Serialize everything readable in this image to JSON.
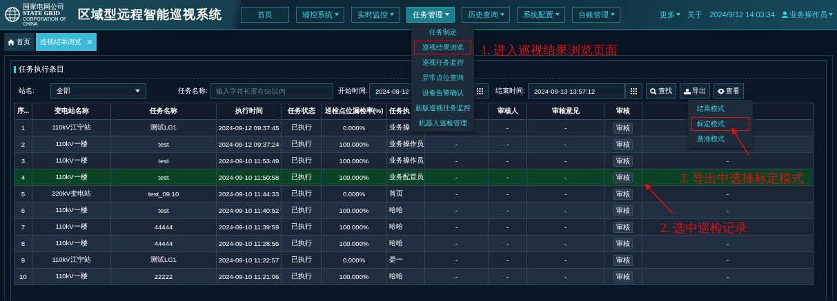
{
  "header": {
    "logo_lines": [
      "国家电网公司",
      "STATE GRID",
      "CORPORATION OF CHINA"
    ],
    "title": "区域型远程智能巡视系统",
    "nav": [
      {
        "label": "首页",
        "dropdown": false,
        "selected": false
      },
      {
        "label": "辅控系统",
        "dropdown": true,
        "selected": false
      },
      {
        "label": "实时监控",
        "dropdown": true,
        "selected": false
      },
      {
        "label": "任务管理",
        "dropdown": true,
        "selected": true
      },
      {
        "label": "历史查询",
        "dropdown": true,
        "selected": false
      },
      {
        "label": "系统配置",
        "dropdown": true,
        "selected": false
      },
      {
        "label": "台账管理",
        "dropdown": true,
        "selected": false
      }
    ],
    "more": "更多",
    "about": "关于",
    "datetime": "2024/9/12 14:03:34",
    "user": "业务操作员"
  },
  "tabs": [
    {
      "label": "首页",
      "kind": "home",
      "selected": false
    },
    {
      "label": "巡视结果浏览",
      "kind": "closable",
      "selected": true
    }
  ],
  "panel": {
    "title": "任务执行条目",
    "filters": {
      "station_label": "站名:",
      "station_value": "全部",
      "task_label": "任务名称:",
      "task_placeholder": "输入字符长度在50以内",
      "start_label": "开始时间:",
      "start_value": "2024-08-12",
      "end_label": "结束时间:",
      "end_value": "2024-09-13 13:57:12"
    },
    "buttons": [
      {
        "label": "查找",
        "kind": "search"
      },
      {
        "label": "导出",
        "kind": "export"
      },
      {
        "label": "查看",
        "kind": "view"
      }
    ],
    "table": {
      "columns": [
        {
          "label": "序..."
        },
        {
          "label": "变电站名称"
        },
        {
          "label": "任务名称"
        },
        {
          "label": "执行时间"
        },
        {
          "label": "任务状态"
        },
        {
          "label": "巡检点位漏检率(%)"
        },
        {
          "label": "任务执"
        },
        {},
        {
          "label": "审核人"
        },
        {
          "label": "审核意见"
        },
        {
          "label": "审核",
          "kind": "button"
        },
        {}
      ],
      "rows": [
        {
          "selected": false,
          "cells": [
            "1",
            "110kV江宁站",
            "测试LG1",
            "2024-09-12 09:37:45",
            "已执行",
            "0.000%",
            "业务操",
            null,
            "-",
            "-",
            "审核",
            null
          ]
        },
        {
          "selected": false,
          "cells": [
            "2",
            "110kV一楼",
            "test",
            "2024-09-12 09:37:24",
            "已执行",
            "100.000%",
            "业务操作员",
            "-",
            "-",
            "-",
            "审核",
            null
          ]
        },
        {
          "selected": false,
          "cells": [
            "3",
            "110kV一楼",
            "test",
            "2024-09-10 11:53:49",
            "已执行",
            "100.000%",
            "业务操作员",
            "-",
            "-",
            "-",
            "审核",
            "-"
          ]
        },
        {
          "selected": true,
          "cells": [
            "4",
            "110kV一楼",
            "test",
            "2024-09-10 11:50:58",
            "已执行",
            "100.000%",
            "业务配置员",
            "-",
            "-",
            "-",
            "审核",
            null
          ]
        },
        {
          "selected": false,
          "cells": [
            "5",
            "220kV变电站",
            "test_09.10",
            "2024-09-10 11:44:33",
            "已执行",
            "0.000%",
            "首页",
            "-",
            "-",
            "-",
            "审核",
            "-"
          ]
        },
        {
          "selected": false,
          "cells": [
            "6",
            "110kV一楼",
            "test",
            "2024-09-10 11:40:52",
            "已执行",
            "100.000%",
            "哈哈",
            "-",
            "-",
            "-",
            "审核",
            "-"
          ]
        },
        {
          "selected": false,
          "cells": [
            "7",
            "110kV一楼",
            "44444",
            "2024-09-10 11:39:59",
            "已执行",
            "100.000%",
            "哈哈",
            "-",
            "-",
            "-",
            "审核",
            null
          ]
        },
        {
          "selected": false,
          "cells": [
            "8",
            "110kV一楼",
            "44444",
            "2024-09-10 11:28:56",
            "已执行",
            "100.000%",
            "哈哈",
            "-",
            "-",
            "-",
            "审核",
            "-"
          ]
        },
        {
          "selected": false,
          "cells": [
            "9",
            "110kV江宁站",
            "测试LG1",
            "2024-09-10 11:22:57",
            "已执行",
            "0.000%",
            "娄一",
            "-",
            "-",
            "-",
            "审核",
            "-"
          ]
        },
        {
          "selected": false,
          "cells": [
            "10",
            "110kV一楼",
            "22222",
            "2024-09-10 11:21:06",
            "已执行",
            "100.000%",
            "哈哈",
            "-",
            "-",
            "-",
            "审核",
            "-"
          ]
        }
      ]
    }
  },
  "task_menu": {
    "items": [
      {
        "label": "任务制定",
        "marked": false
      },
      {
        "label": "巡视结果浏览",
        "marked": true
      },
      {
        "label": "巡视任务监控",
        "marked": false
      },
      {
        "label": "异常点位查询",
        "marked": false
      },
      {
        "label": "设备告警确认",
        "marked": false
      },
      {
        "label": "新版巡视任务监控",
        "marked": false
      },
      {
        "label": "机器人巡检管理",
        "marked": false
      }
    ]
  },
  "export_menu": {
    "items": [
      {
        "label": "结果模式",
        "marked": false
      },
      {
        "label": "标定模式",
        "marked": true
      },
      {
        "label": "基准模式",
        "marked": false
      }
    ]
  },
  "annotations": [
    {
      "text": "1. 进入巡视结果浏览页面",
      "arrow": false
    },
    {
      "text": "3. 导出中选择标定模式",
      "arrow": true
    },
    {
      "text": "2. 选中巡检记录",
      "arrow": true
    }
  ]
}
